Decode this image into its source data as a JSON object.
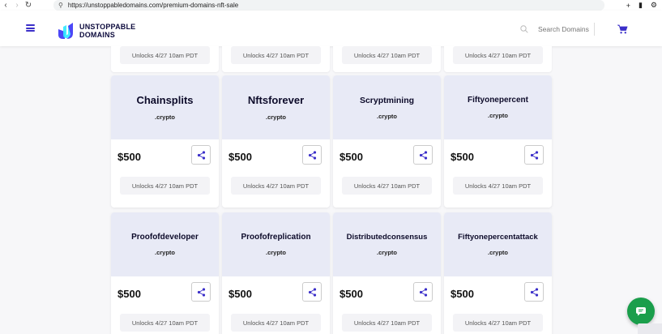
{
  "browser": {
    "url": "https://unstoppabledomains.com/premium-domains-nft-sale"
  },
  "header": {
    "logo_line1": "UNSTOPPABLE",
    "logo_line2": "DOMAINS",
    "search_placeholder": "Search Domains"
  },
  "colors": {
    "accent": "#3b2fc9",
    "banner": "#e8eaf6",
    "chat": "#1a9e4b"
  },
  "top_partial": [
    {
      "unlock": "Unlocks 4/27 10am PDT"
    },
    {
      "unlock": "Unlocks 4/27 10am PDT"
    },
    {
      "unlock": "Unlocks 4/27 10am PDT"
    },
    {
      "unlock": "Unlocks 4/27 10am PDT"
    }
  ],
  "rows": [
    [
      {
        "name": "Chainsplits",
        "ext": ".crypto",
        "price": "$500",
        "unlock": "Unlocks 4/27 10am PDT"
      },
      {
        "name": "Nftsforever",
        "ext": ".crypto",
        "price": "$500",
        "unlock": "Unlocks 4/27 10am PDT"
      },
      {
        "name": "Scryptmining",
        "ext": ".crypto",
        "price": "$500",
        "unlock": "Unlocks 4/27 10am PDT"
      },
      {
        "name": "Fiftyonepercent",
        "ext": ".crypto",
        "price": "$500",
        "unlock": "Unlocks 4/27 10am PDT"
      }
    ],
    [
      {
        "name": "Proofofdeveloper",
        "ext": ".crypto",
        "price": "$500",
        "unlock": "Unlocks 4/27 10am PDT"
      },
      {
        "name": "Proofofreplication",
        "ext": ".crypto",
        "price": "$500",
        "unlock": "Unlocks 4/27 10am PDT"
      },
      {
        "name": "Distributedconsensus",
        "ext": ".crypto",
        "price": "$500",
        "unlock": "Unlocks 4/27 10am PDT"
      },
      {
        "name": "Fiftyonepercentattack",
        "ext": ".crypto",
        "price": "$500",
        "unlock": "Unlocks 4/27 10am PDT"
      }
    ]
  ]
}
